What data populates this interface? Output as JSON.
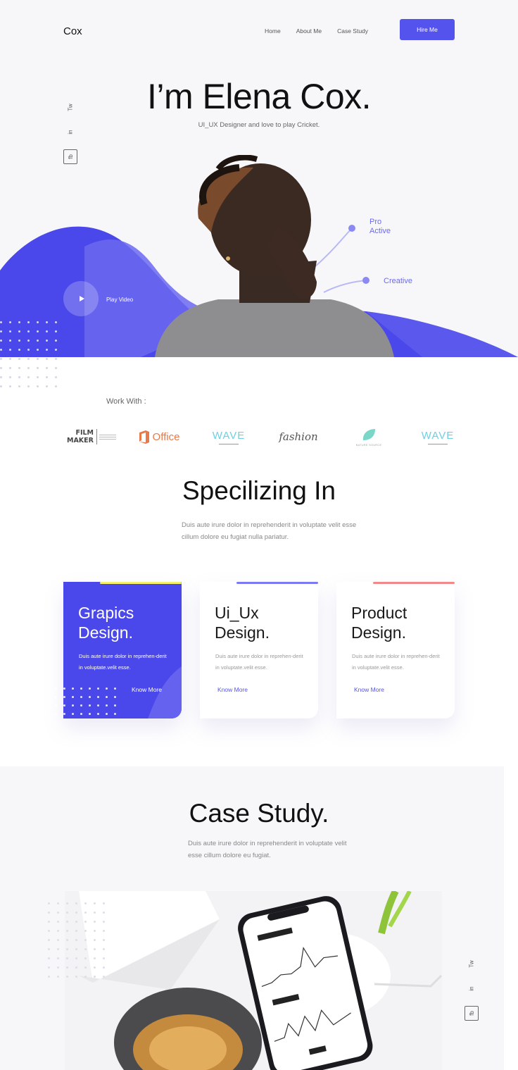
{
  "header": {
    "logo": "Cox",
    "nav": [
      "Home",
      "About Me",
      "Case Study"
    ],
    "hire_label": "Hire Me"
  },
  "hero": {
    "title": "I’m Elena Cox.",
    "subtitle": "UI_UX Designer and love to play Cricket.",
    "play_label": "Play Video",
    "tags": [
      "Pro\nActive",
      "Creative"
    ]
  },
  "social": {
    "tw": "Tw",
    "in": "in",
    "fb": "fb"
  },
  "work": {
    "label": "Work With :",
    "brands": [
      {
        "line1": "FILM",
        "line2": "MAKER"
      },
      {
        "name": "Office"
      },
      {
        "name": "WAVE"
      },
      {
        "name": "fashion"
      },
      {
        "name": "NATURE SOURCE"
      },
      {
        "name": "WAVE"
      }
    ]
  },
  "specializing": {
    "title": "Specilizing In",
    "desc": "Duis aute irure dolor in reprehenderit in voluptate velit esse cillum dolore eu fugiat nulla pariatur.",
    "cards": [
      {
        "title": "Grapics\nDesign.",
        "desc": "Duis aute irure dolor in reprehen-derit in voluptate.velit esse.",
        "more": "Know More"
      },
      {
        "title": "Ui_Ux\nDesign.",
        "desc": "Duis aute irure dolor in reprehen-derit in voluptate.velit esse.",
        "more": "Know More"
      },
      {
        "title": "Product\nDesign.",
        "desc": "Duis aute irure dolor in reprehen-derit in voluptate.velit esse.",
        "more": "Know More"
      }
    ]
  },
  "case_study": {
    "title": "Case Study.",
    "desc": "Duis aute irure dolor in reprehenderit in voluptate velit esse cillum dolore eu fugiat."
  },
  "colors": {
    "primary": "#5553ee",
    "wave_light": "#6f6df0",
    "accent_red": "#f08a8a"
  }
}
